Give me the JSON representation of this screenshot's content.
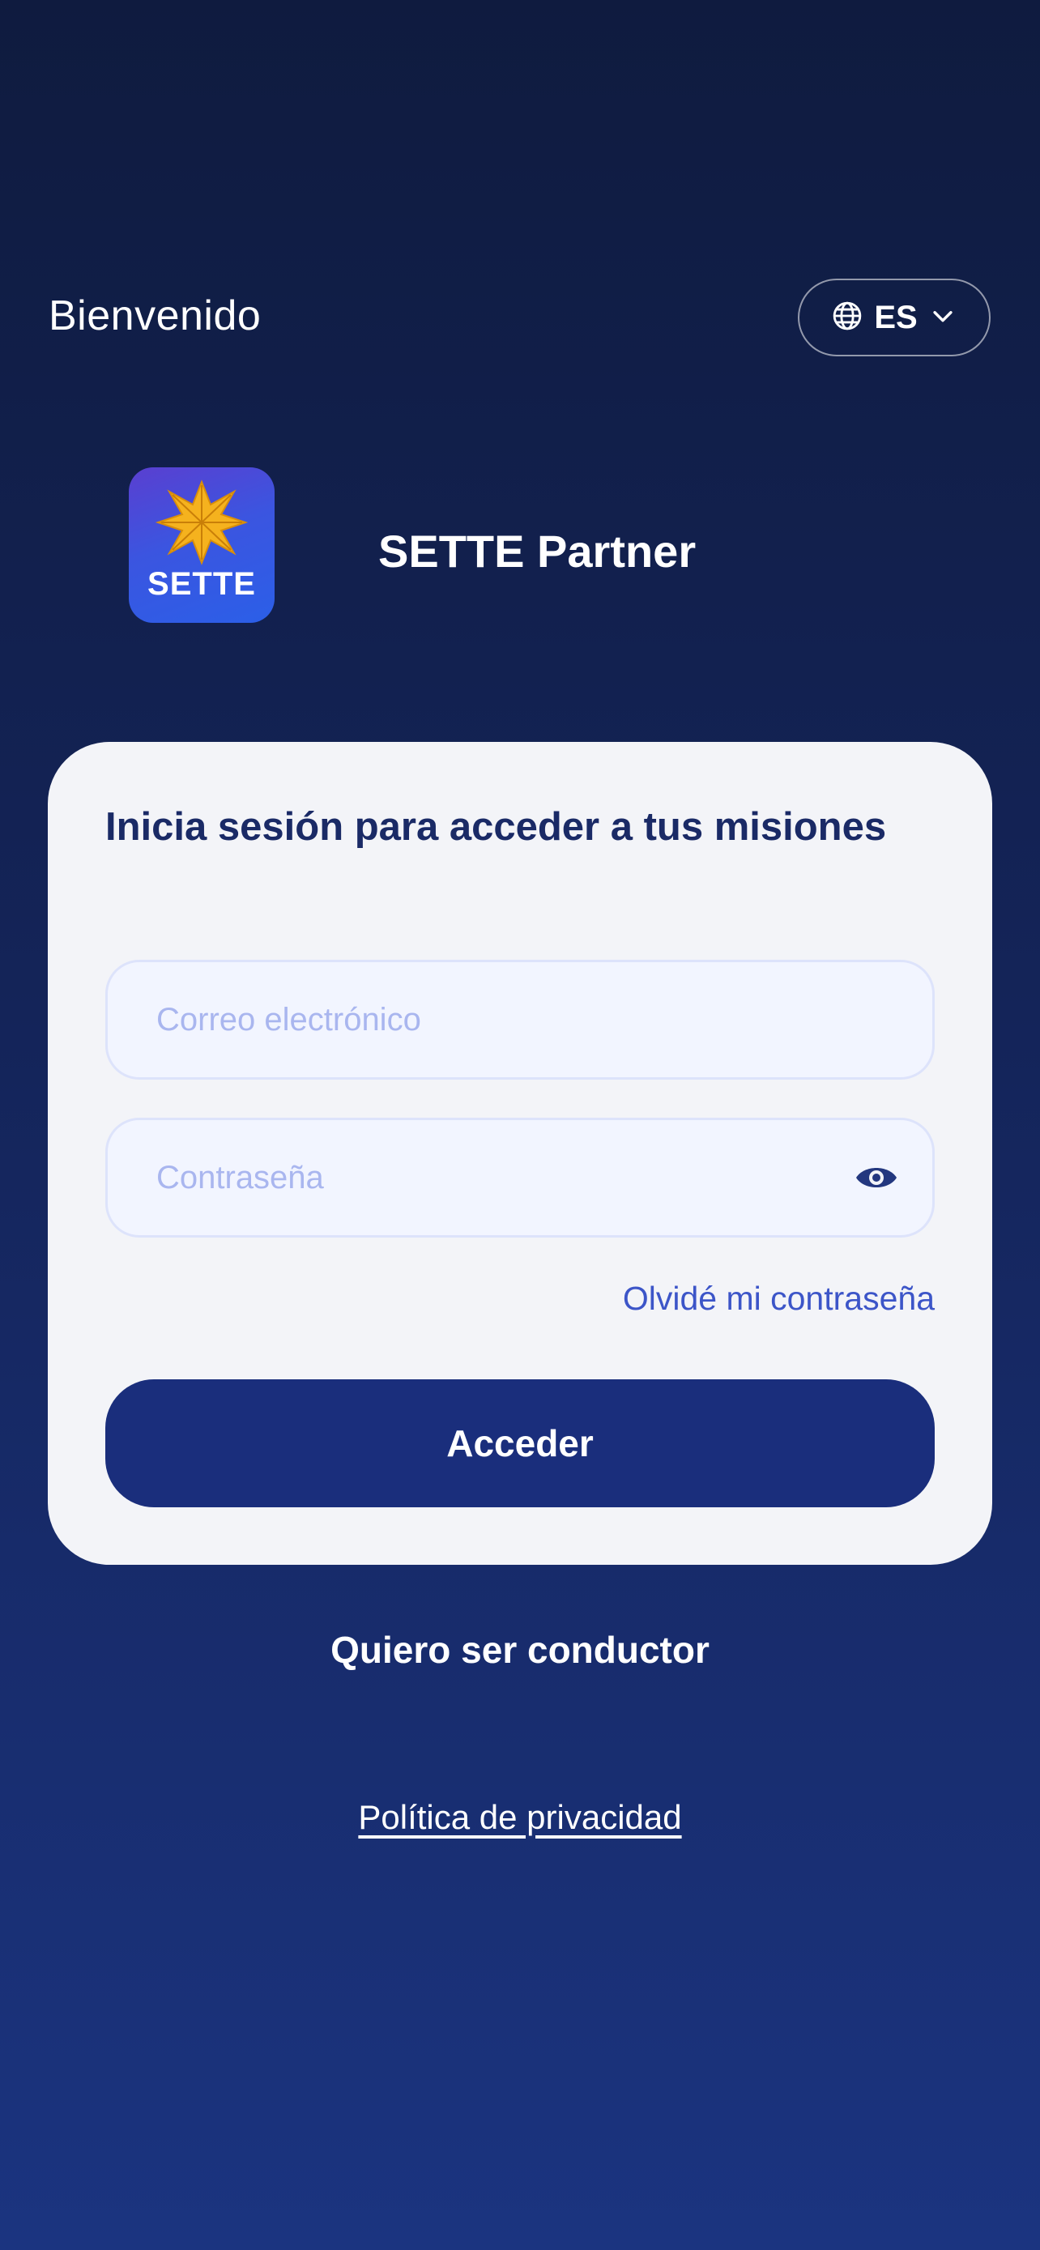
{
  "header": {
    "welcome_text": "Bienvenido",
    "language": {
      "label": "ES",
      "icon": "globe-icon",
      "chevron_icon": "chevron-down-icon"
    }
  },
  "brand": {
    "logo_text": "SETTE",
    "logo_icon": "star-icon",
    "app_name": "SETTE Partner",
    "colors": {
      "star": "#f5b21e",
      "tile_gradient_start": "#5a3fd0",
      "tile_gradient_end": "#2b5fe8"
    }
  },
  "login_card": {
    "title": "Inicia sesión para acceder a tus misiones",
    "email": {
      "placeholder": "Correo electrónico",
      "value": ""
    },
    "password": {
      "placeholder": "Contraseña",
      "value": "",
      "toggle_icon": "eye-icon"
    },
    "forgot_password_label": "Olvidé mi contraseña",
    "submit_label": "Acceder"
  },
  "footer": {
    "driver_signup_label": "Quiero ser conductor",
    "privacy_policy_label": "Política de privacidad"
  },
  "colors": {
    "background_top": "#0f1b3f",
    "background_bottom": "#1b3480",
    "primary_button": "#1a2e7c",
    "link_accent": "#3c55c8",
    "card_background": "#f3f4f8"
  }
}
